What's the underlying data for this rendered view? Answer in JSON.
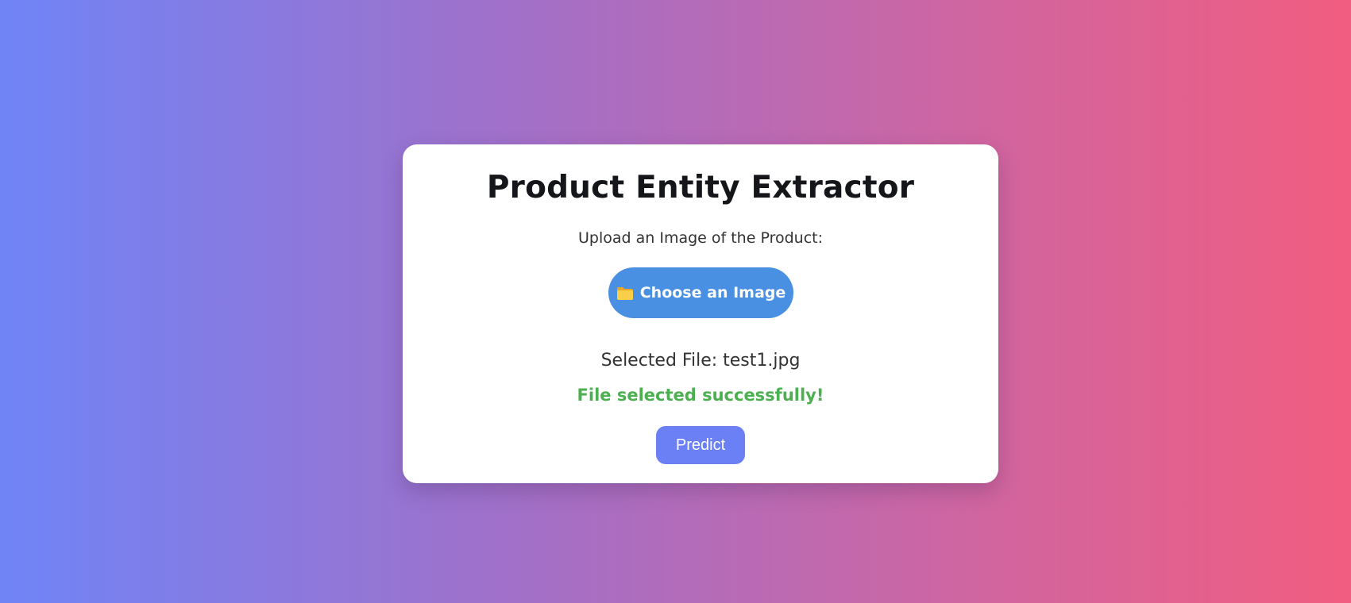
{
  "page": {
    "title": "Product Entity Extractor",
    "upload_label": "Upload an Image of the Product:",
    "choose_button": {
      "icon": "folder-icon",
      "label": "Choose an Image"
    },
    "selected_file": "Selected File: test1.jpg",
    "status_message": "File selected successfully!",
    "predict_label": "Predict"
  },
  "colors": {
    "background_gradient": [
      "#6f84f7",
      "#a46fc6",
      "#cd66a3",
      "#f15d80"
    ],
    "card_background": "#ffffff",
    "choose_button": "#4a90e2",
    "success_text": "#4caf50",
    "predict_button": "#6c80f6",
    "folder_icon": "#f5c842"
  }
}
